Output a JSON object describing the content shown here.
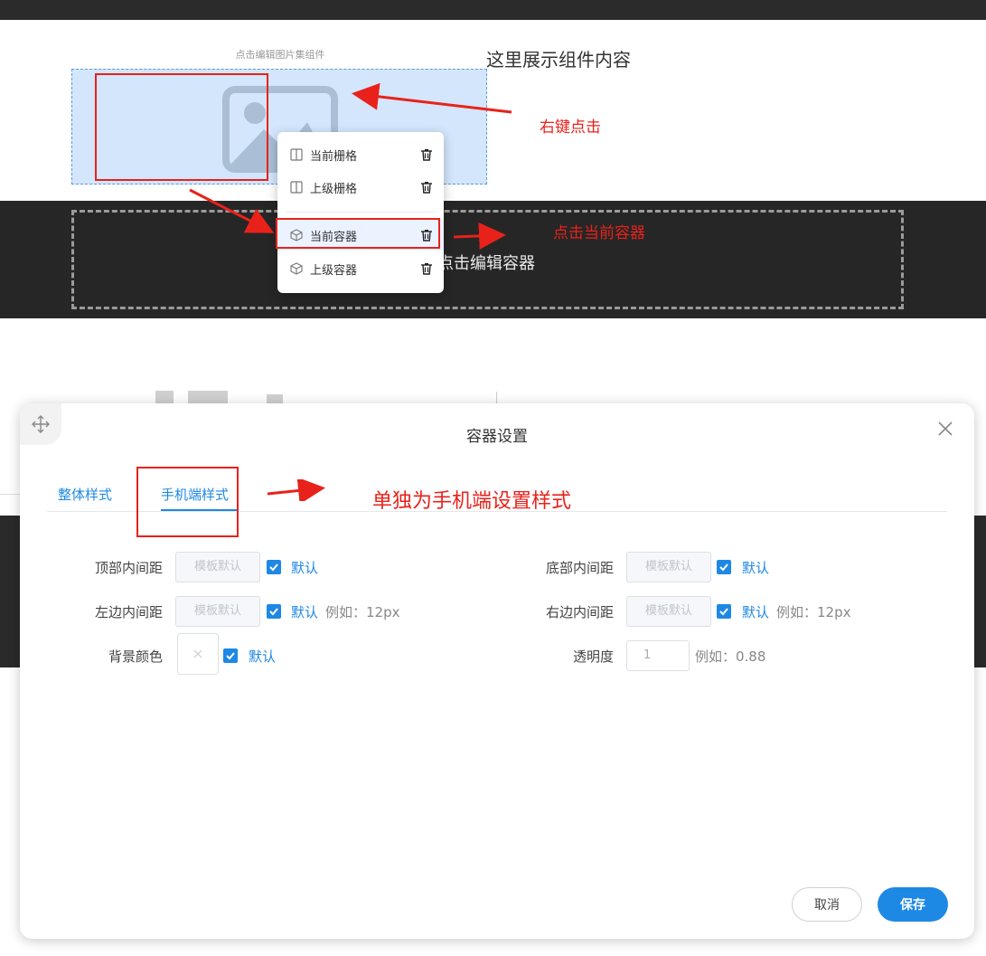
{
  "canvas": {
    "gallery_caption": "点击编辑图片集组件",
    "component_text": "这里展示组件内容",
    "container_text": "点击编辑容器"
  },
  "context_menu": {
    "items": [
      {
        "label": "当前栅格",
        "icon": "column-icon"
      },
      {
        "label": "上级栅格",
        "icon": "column-icon"
      },
      {
        "label": "当前容器",
        "icon": "cube-icon"
      },
      {
        "label": "上级容器",
        "icon": "cube-icon"
      }
    ],
    "active_index": 2
  },
  "annotations": {
    "right_click": "右键点击",
    "click_container": "点击当前容器",
    "mobile_note": "单独为手机端设置样式"
  },
  "dialog": {
    "title": "容器设置",
    "tabs": [
      {
        "label": "整体样式"
      },
      {
        "label": "手机端样式",
        "active": true
      }
    ],
    "fields": {
      "top_padding": {
        "label": "顶部内间距",
        "placeholder": "模板默认",
        "checkbox_label": "默认",
        "checked": true
      },
      "bottom_padding": {
        "label": "底部内间距",
        "placeholder": "模板默认",
        "checkbox_label": "默认",
        "checked": true
      },
      "left_padding": {
        "label": "左边内间距",
        "placeholder": "模板默认",
        "checkbox_label": "默认",
        "checked": true,
        "hint": "例如：12px"
      },
      "right_padding": {
        "label": "右边内间距",
        "placeholder": "模板默认",
        "checkbox_label": "默认",
        "checked": true,
        "hint": "例如：12px"
      },
      "bg_color": {
        "label": "背景颜色",
        "checkbox_label": "默认",
        "checked": true
      },
      "opacity": {
        "label": "透明度",
        "value": "1",
        "hint": "例如：0.88"
      }
    },
    "buttons": {
      "cancel": "取消",
      "save": "保存"
    }
  },
  "colors": {
    "accent": "#1e88e5",
    "annotation_red": "#e8221b",
    "dark_band": "#262626",
    "gallery_bg": "#d4e6fb"
  }
}
